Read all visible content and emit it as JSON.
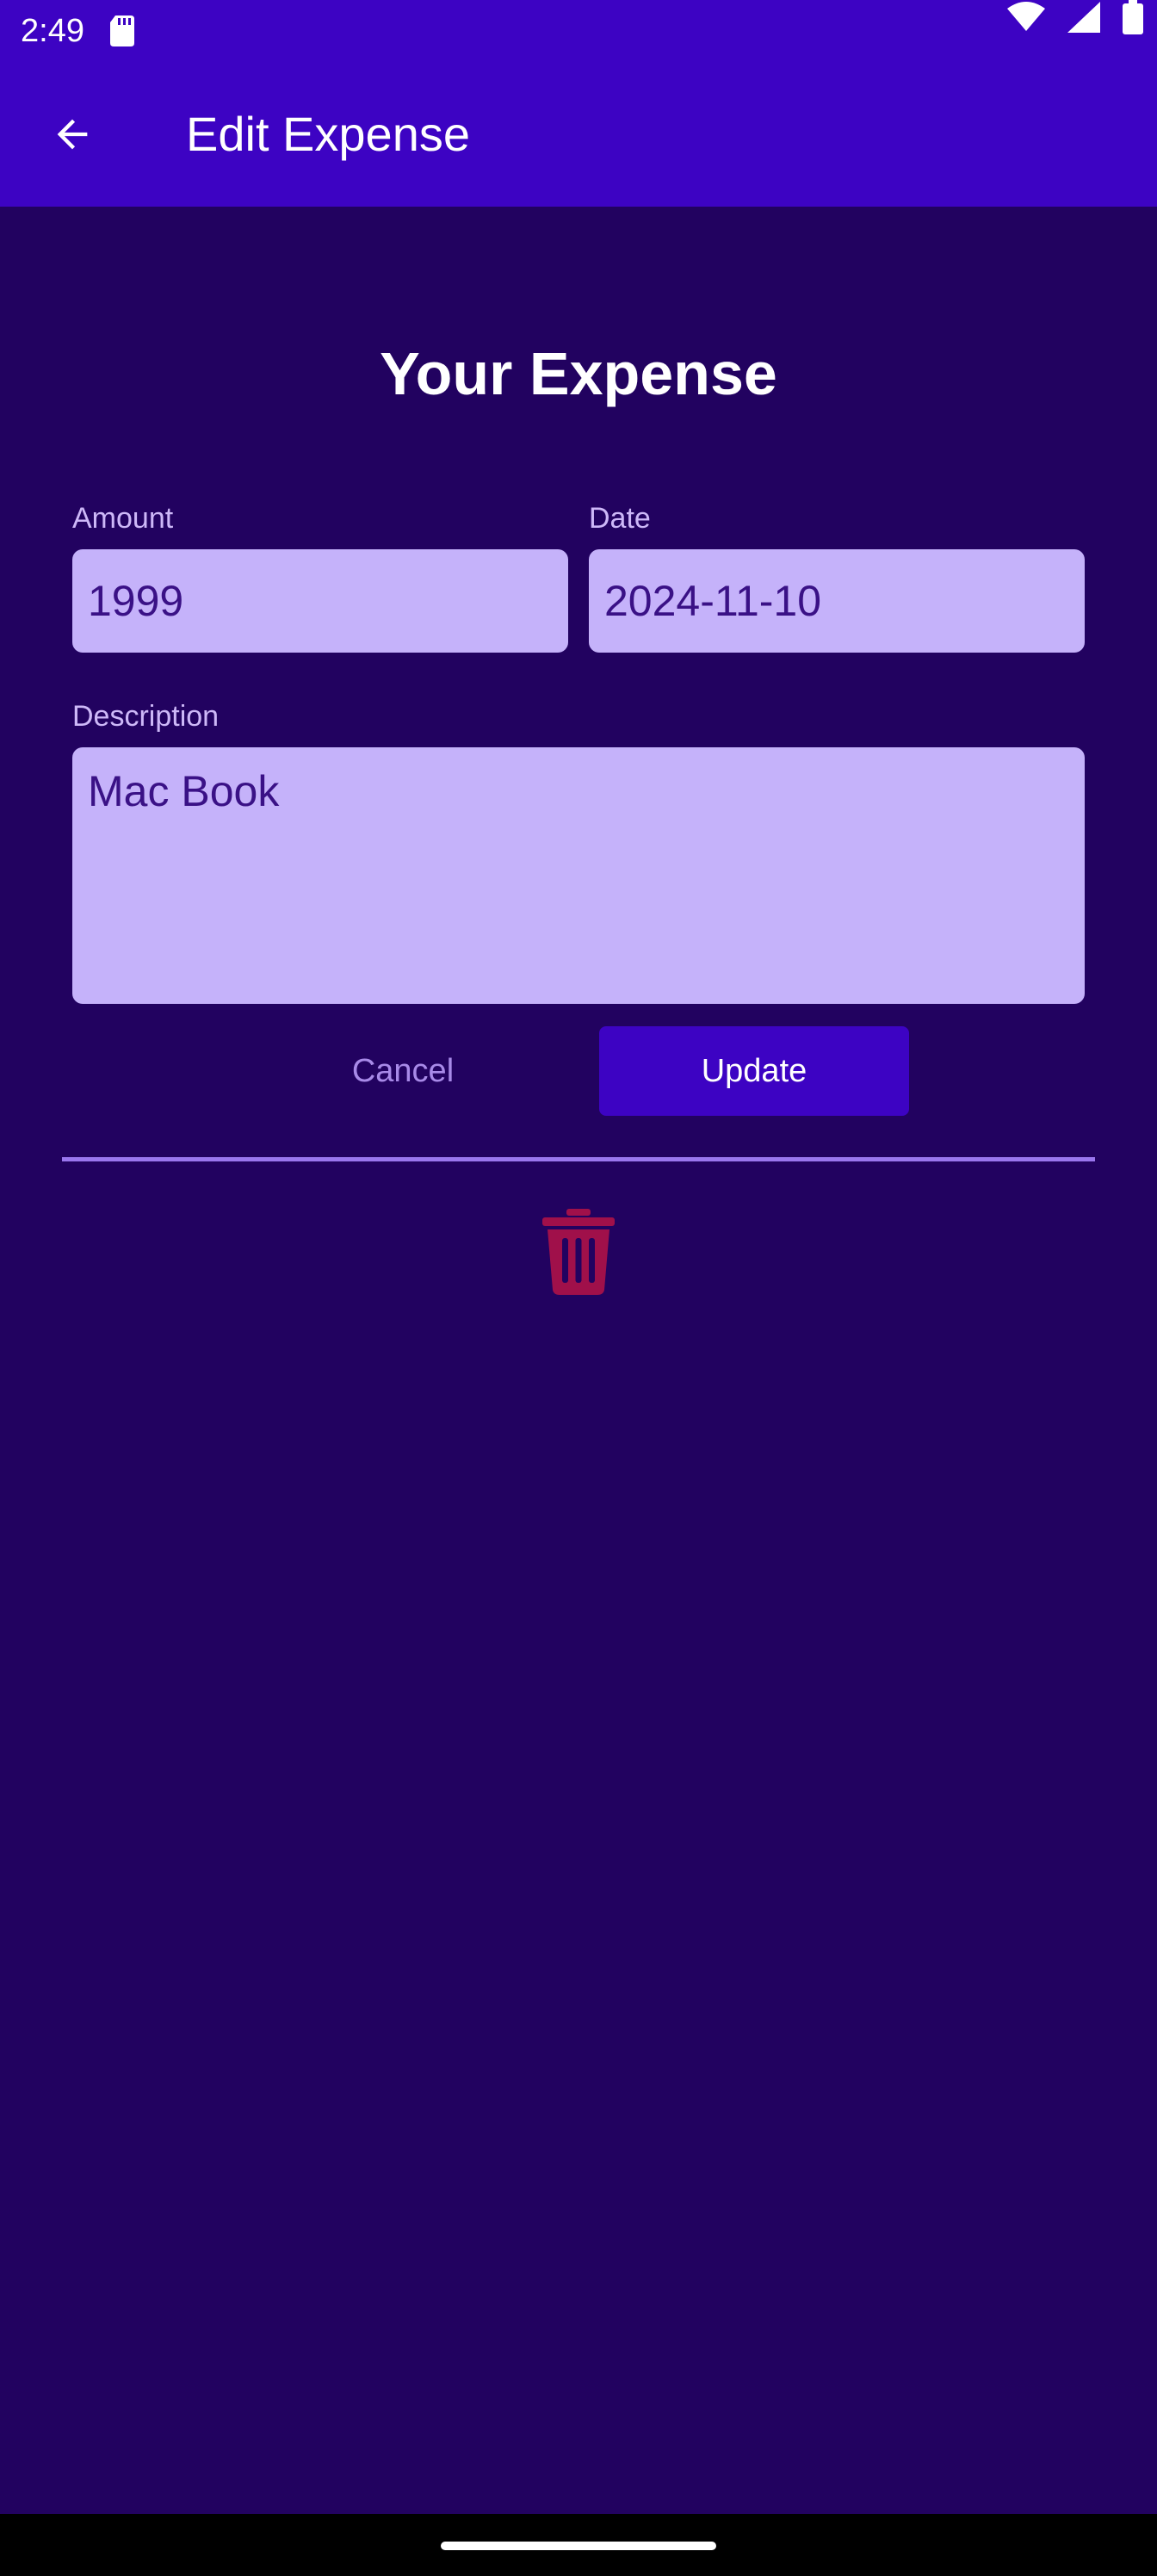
{
  "status_bar": {
    "time": "2:49",
    "icons": [
      "sd-card-icon",
      "wifi-icon",
      "signal-icon",
      "battery-icon"
    ]
  },
  "app_bar": {
    "back_icon": "arrow-back-icon",
    "title": "Edit Expense"
  },
  "form": {
    "heading": "Your Expense",
    "amount": {
      "label": "Amount",
      "value": "1999"
    },
    "date": {
      "label": "Date",
      "value": "2024-11-10"
    },
    "description": {
      "label": "Description",
      "value": "Mac Book"
    },
    "cancel_label": "Cancel",
    "update_label": "Update"
  },
  "delete": {
    "icon": "trash-icon"
  },
  "colors": {
    "primary": "#3d03c3",
    "background": "#220260",
    "input_fill": "#c5b2fa",
    "label": "#cdb8f8",
    "delete": "#a0104a",
    "divider": "#9a76ee"
  }
}
